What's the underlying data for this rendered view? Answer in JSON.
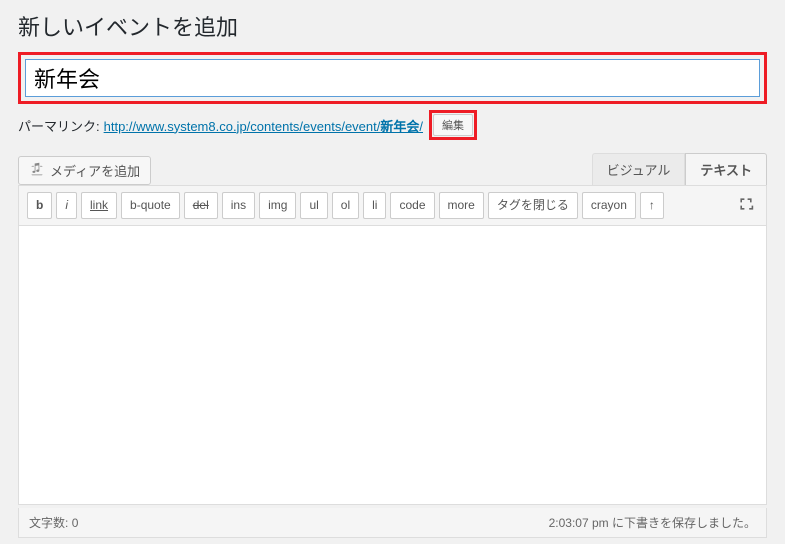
{
  "page": {
    "title": "新しいイベントを追加"
  },
  "post": {
    "title_value": "新年会"
  },
  "permalink": {
    "label": "パーマリンク:",
    "url_prefix": "http://www.system8.co.jp/contents/events/event/",
    "slug": "新年会",
    "url_suffix": "/",
    "edit_label": "編集"
  },
  "media": {
    "add_label": "メディアを追加"
  },
  "editor_tabs": {
    "visual": "ビジュアル",
    "text": "テキスト"
  },
  "quicktags": {
    "b": "b",
    "i": "i",
    "link": "link",
    "bquote": "b-quote",
    "del": "del",
    "ins": "ins",
    "img": "img",
    "ul": "ul",
    "ol": "ol",
    "li": "li",
    "code": "code",
    "more": "more",
    "close": "タグを閉じる",
    "crayon": "crayon",
    "pi": "↑"
  },
  "status": {
    "word_count_label": "文字数:",
    "word_count_value": "0",
    "save_message": "2:03:07 pm に下書きを保存しました。"
  }
}
